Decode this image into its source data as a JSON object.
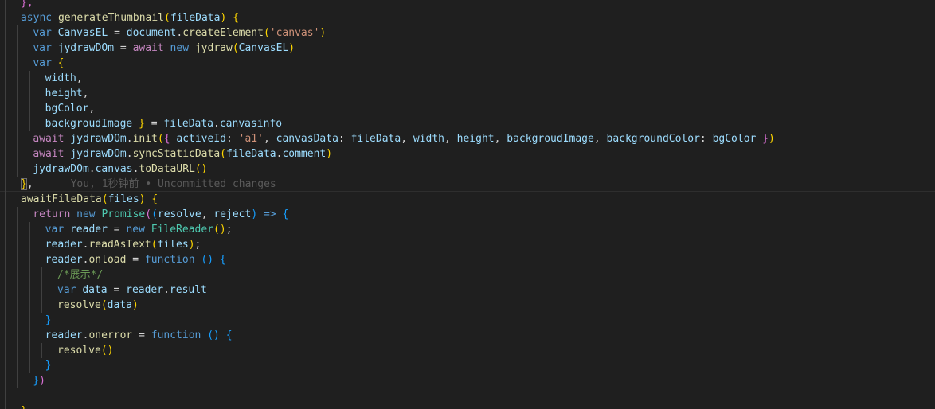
{
  "editor": {
    "lines": [
      {
        "indent": 1,
        "current": false,
        "tokens": [
          [
            "b2",
            "},"
          ]
        ]
      },
      {
        "indent": 1,
        "current": false,
        "tokens": [
          [
            "kw",
            "async "
          ],
          [
            "fn",
            "generateThumbnail"
          ],
          [
            "b1",
            "("
          ],
          [
            "prm",
            "fileData"
          ],
          [
            "b1",
            ")"
          ],
          [
            "pun",
            " "
          ],
          [
            "b1",
            "{"
          ]
        ]
      },
      {
        "indent": 2,
        "current": false,
        "tokens": [
          [
            "kw",
            "var "
          ],
          [
            "var",
            "CanvasEL"
          ],
          [
            "pun",
            " = "
          ],
          [
            "var",
            "document"
          ],
          [
            "pun",
            "."
          ],
          [
            "fn",
            "createElement"
          ],
          [
            "b1",
            "("
          ],
          [
            "str",
            "'canvas'"
          ],
          [
            "b1",
            ")"
          ]
        ]
      },
      {
        "indent": 2,
        "current": false,
        "tokens": [
          [
            "kw",
            "var "
          ],
          [
            "var",
            "jydrawDOm"
          ],
          [
            "pun",
            " = "
          ],
          [
            "ctl",
            "await "
          ],
          [
            "kw",
            "new "
          ],
          [
            "fn",
            "jydraw"
          ],
          [
            "b1",
            "("
          ],
          [
            "var",
            "CanvasEL"
          ],
          [
            "b1",
            ")"
          ]
        ]
      },
      {
        "indent": 2,
        "current": false,
        "tokens": [
          [
            "kw",
            "var "
          ],
          [
            "b1",
            "{"
          ]
        ]
      },
      {
        "indent": 3,
        "current": false,
        "tokens": [
          [
            "var",
            "width"
          ],
          [
            "pun",
            ","
          ]
        ]
      },
      {
        "indent": 3,
        "current": false,
        "tokens": [
          [
            "var",
            "height"
          ],
          [
            "pun",
            ","
          ]
        ]
      },
      {
        "indent": 3,
        "current": false,
        "tokens": [
          [
            "var",
            "bgColor"
          ],
          [
            "pun",
            ","
          ]
        ]
      },
      {
        "indent": 3,
        "current": false,
        "tokens": [
          [
            "var",
            "backgroudImage"
          ],
          [
            "pun",
            " "
          ],
          [
            "b1",
            "}"
          ],
          [
            "pun",
            " = "
          ],
          [
            "var",
            "fileData"
          ],
          [
            "pun",
            "."
          ],
          [
            "var",
            "canvasinfo"
          ]
        ]
      },
      {
        "indent": 2,
        "current": false,
        "tokens": [
          [
            "ctl",
            "await "
          ],
          [
            "var",
            "jydrawDOm"
          ],
          [
            "pun",
            "."
          ],
          [
            "fn",
            "init"
          ],
          [
            "b1",
            "("
          ],
          [
            "b2",
            "{"
          ],
          [
            "pun",
            " "
          ],
          [
            "var",
            "activeId"
          ],
          [
            "pun",
            ": "
          ],
          [
            "str",
            "'a1'"
          ],
          [
            "pun",
            ", "
          ],
          [
            "var",
            "canvasData"
          ],
          [
            "pun",
            ": "
          ],
          [
            "var",
            "fileData"
          ],
          [
            "pun",
            ", "
          ],
          [
            "var",
            "width"
          ],
          [
            "pun",
            ", "
          ],
          [
            "var",
            "height"
          ],
          [
            "pun",
            ", "
          ],
          [
            "var",
            "backgroudImage"
          ],
          [
            "pun",
            ", "
          ],
          [
            "var",
            "backgroundColor"
          ],
          [
            "pun",
            ": "
          ],
          [
            "var",
            "bgColor"
          ],
          [
            "pun",
            " "
          ],
          [
            "b2",
            "}"
          ],
          [
            "b1",
            ")"
          ]
        ]
      },
      {
        "indent": 2,
        "current": false,
        "tokens": [
          [
            "ctl",
            "await "
          ],
          [
            "var",
            "jydrawDOm"
          ],
          [
            "pun",
            "."
          ],
          [
            "fn",
            "syncStaticData"
          ],
          [
            "b1",
            "("
          ],
          [
            "var",
            "fileData"
          ],
          [
            "pun",
            "."
          ],
          [
            "var",
            "comment"
          ],
          [
            "b1",
            ")"
          ]
        ]
      },
      {
        "indent": 2,
        "current": false,
        "tokens": [
          [
            "var",
            "jydrawDOm"
          ],
          [
            "pun",
            "."
          ],
          [
            "var",
            "canvas"
          ],
          [
            "pun",
            "."
          ],
          [
            "fn",
            "toDataURL"
          ],
          [
            "b1",
            "()"
          ]
        ]
      },
      {
        "indent": 1,
        "current": true,
        "tokens": [
          [
            "b1m",
            "}"
          ],
          [
            "pun",
            ","
          ],
          [
            "blame",
            "      You, 1秒钟前 • Uncommitted changes"
          ]
        ]
      },
      {
        "indent": 1,
        "current": false,
        "tokens": [
          [
            "fn",
            "awaitFileData"
          ],
          [
            "b1",
            "("
          ],
          [
            "prm",
            "files"
          ],
          [
            "b1",
            ")"
          ],
          [
            "pun",
            " "
          ],
          [
            "b1",
            "{"
          ]
        ]
      },
      {
        "indent": 2,
        "current": false,
        "tokens": [
          [
            "ctl",
            "return "
          ],
          [
            "kw",
            "new "
          ],
          [
            "cls",
            "Promise"
          ],
          [
            "b2",
            "("
          ],
          [
            "b3",
            "("
          ],
          [
            "prm",
            "resolve"
          ],
          [
            "pun",
            ", "
          ],
          [
            "prm",
            "reject"
          ],
          [
            "b3",
            ")"
          ],
          [
            "pun",
            " "
          ],
          [
            "kw",
            "=>"
          ],
          [
            "pun",
            " "
          ],
          [
            "b3",
            "{"
          ]
        ]
      },
      {
        "indent": 3,
        "current": false,
        "tokens": [
          [
            "kw",
            "var "
          ],
          [
            "var",
            "reader"
          ],
          [
            "pun",
            " = "
          ],
          [
            "kw",
            "new "
          ],
          [
            "cls",
            "FileReader"
          ],
          [
            "b1",
            "()"
          ],
          [
            "pun",
            ";"
          ]
        ]
      },
      {
        "indent": 3,
        "current": false,
        "tokens": [
          [
            "var",
            "reader"
          ],
          [
            "pun",
            "."
          ],
          [
            "fn",
            "readAsText"
          ],
          [
            "b1",
            "("
          ],
          [
            "var",
            "files"
          ],
          [
            "b1",
            ")"
          ],
          [
            "pun",
            ";"
          ]
        ]
      },
      {
        "indent": 3,
        "current": false,
        "tokens": [
          [
            "var",
            "reader"
          ],
          [
            "pun",
            "."
          ],
          [
            "fn",
            "onload"
          ],
          [
            "pun",
            " = "
          ],
          [
            "kw",
            "function"
          ],
          [
            "pun",
            " "
          ],
          [
            "b3",
            "()"
          ],
          [
            "pun",
            " "
          ],
          [
            "b3",
            "{"
          ]
        ]
      },
      {
        "indent": 4,
        "current": false,
        "tokens": [
          [
            "cmt",
            "/*展示*/"
          ]
        ]
      },
      {
        "indent": 4,
        "current": false,
        "tokens": [
          [
            "kw",
            "var "
          ],
          [
            "var",
            "data"
          ],
          [
            "pun",
            " = "
          ],
          [
            "var",
            "reader"
          ],
          [
            "pun",
            "."
          ],
          [
            "var",
            "result"
          ]
        ]
      },
      {
        "indent": 4,
        "current": false,
        "tokens": [
          [
            "fn",
            "resolve"
          ],
          [
            "b1",
            "("
          ],
          [
            "var",
            "data"
          ],
          [
            "b1",
            ")"
          ]
        ]
      },
      {
        "indent": 3,
        "current": false,
        "tokens": [
          [
            "b3",
            "}"
          ]
        ]
      },
      {
        "indent": 3,
        "current": false,
        "tokens": [
          [
            "var",
            "reader"
          ],
          [
            "pun",
            "."
          ],
          [
            "fn",
            "onerror"
          ],
          [
            "pun",
            " = "
          ],
          [
            "kw",
            "function"
          ],
          [
            "pun",
            " "
          ],
          [
            "b3",
            "()"
          ],
          [
            "pun",
            " "
          ],
          [
            "b3",
            "{"
          ]
        ]
      },
      {
        "indent": 4,
        "current": false,
        "tokens": [
          [
            "fn",
            "resolve"
          ],
          [
            "b1",
            "()"
          ]
        ]
      },
      {
        "indent": 3,
        "current": false,
        "tokens": [
          [
            "b3",
            "}"
          ]
        ]
      },
      {
        "indent": 2,
        "current": false,
        "tokens": [
          [
            "b3",
            "}"
          ],
          [
            "b2",
            ")"
          ]
        ]
      },
      {
        "indent": 1,
        "current": false,
        "tokens": []
      },
      {
        "indent": 1,
        "current": false,
        "tokens": [
          [
            "b1",
            "},"
          ]
        ]
      }
    ]
  }
}
